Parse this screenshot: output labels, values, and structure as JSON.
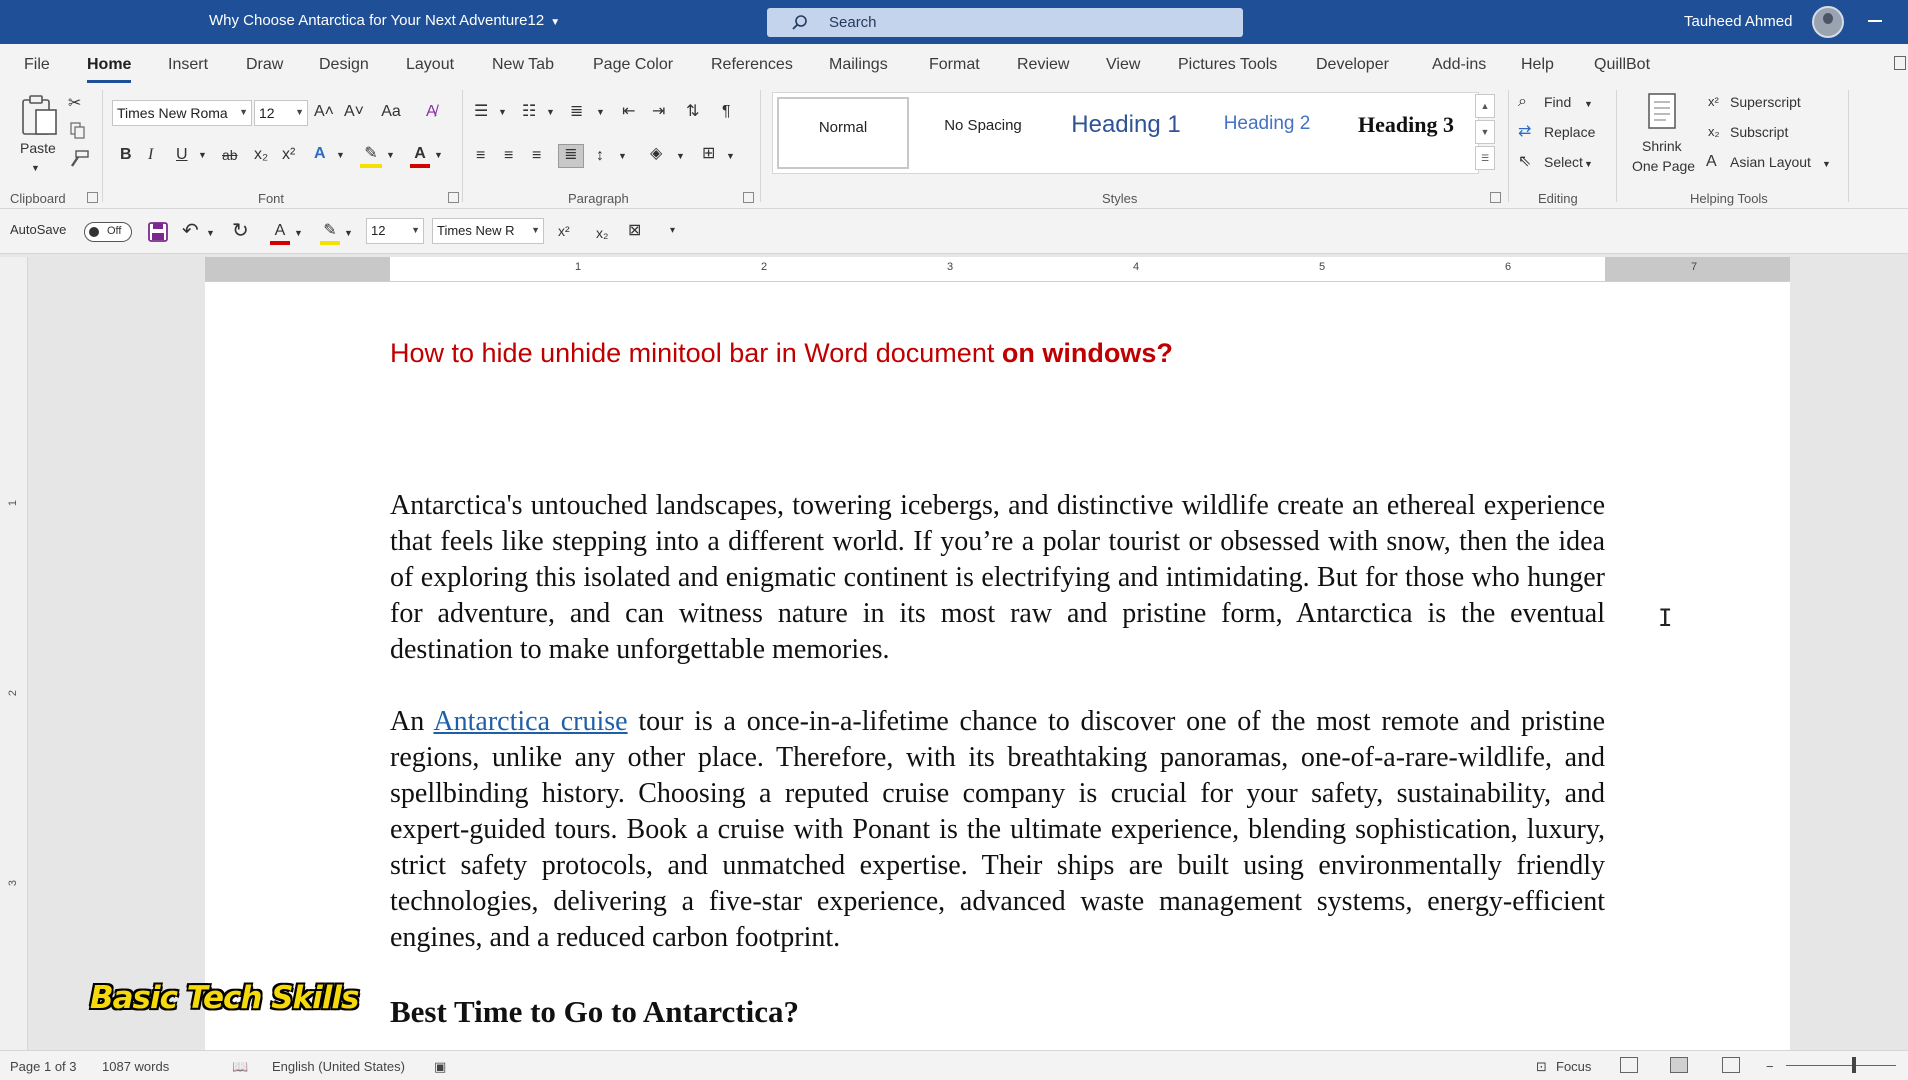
{
  "window": {
    "title": "Why Choose Antarctica for Your Next Adventure12",
    "search_placeholder": "Search",
    "user_name": "Tauheed Ahmed"
  },
  "menu": {
    "tabs": [
      "File",
      "Home",
      "Insert",
      "Draw",
      "Design",
      "Layout",
      "New Tab",
      "Page Color",
      "References",
      "Mailings",
      "Format",
      "Review",
      "View",
      "Pictures Tools",
      "Developer",
      "Add-ins",
      "Help",
      "QuillBot"
    ],
    "active": "Home"
  },
  "ribbon": {
    "clipboard": {
      "paste": "Paste",
      "label": "Clipboard"
    },
    "font": {
      "family": "Times New Roma",
      "size": "12",
      "label": "Font",
      "bold": "B",
      "italic": "I",
      "underline": "U",
      "strike": "ab",
      "sub": "x₂",
      "sup": "x²",
      "case": "Aa",
      "grow": "A˄",
      "shrink": "A˅"
    },
    "paragraph": {
      "label": "Paragraph"
    },
    "styles": {
      "label": "Styles",
      "items": [
        "Normal",
        "No Spacing",
        "Heading 1",
        "Heading 2",
        "Heading 3"
      ]
    },
    "editing": {
      "find": "Find",
      "replace": "Replace",
      "select": "Select",
      "label": "Editing"
    },
    "helping_tools": {
      "shrink_line1": "Shrink",
      "shrink_line2": "One Page",
      "superscript": "Superscript",
      "subscript": "Subscript",
      "asian_layout": "Asian Layout",
      "label": "Helping Tools"
    }
  },
  "qat": {
    "autosave": "AutoSave",
    "autosave_state": "Off",
    "font_size": "12",
    "font_family": "Times New R"
  },
  "ruler": {
    "numbers": [
      "1",
      "2",
      "3",
      "4",
      "5",
      "6",
      "7"
    ]
  },
  "document": {
    "heading_plain": "How to hide unhide minitool bar in Word document ",
    "heading_bold": "on windows?",
    "para1": "Antarctica's untouched landscapes, towering icebergs, and distinctive wildlife create an ethereal experience that feels like stepping into a different world. If you’re a polar tourist or obsessed with snow, then the idea of exploring this isolated and enigmatic continent is electrifying and intimidating. But for those who hunger for adventure, and can witness nature in its most raw and pristine form, Antarctica is the eventual destination to make unforgettable memories.",
    "para2_start": "An ",
    "para2_link": "Antarctica cruise",
    "para2_rest": " tour is a once-in-a-lifetime chance to discover one of the most remote and pristine regions, unlike any other place. Therefore, with its breathtaking panoramas, one-of-a-rare-wildlife, and spellbinding history. Choosing a reputed cruise company is crucial for your safety, sustainability, and expert-guided tours. Book a cruise with Ponant is the ultimate experience, blending sophistication, luxury, strict safety protocols, and unmatched expertise. Their ships are built using environmentally friendly technologies, delivering a five-star experience, advanced waste management systems, energy-efficient engines, and a reduced carbon footprint.",
    "heading3": "Best Time to Go to Antarctica?"
  },
  "watermark": "Basic Tech Skills",
  "status": {
    "page": "Page 1 of 3",
    "words": "1087 words",
    "language": "English (United States)",
    "focus": "Focus"
  },
  "colors": {
    "titlebar": "#1e4f97",
    "heading_red": "#c00000",
    "link": "#1f5fa8"
  }
}
